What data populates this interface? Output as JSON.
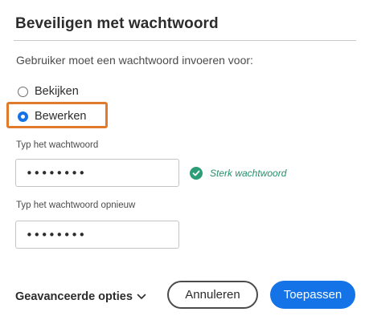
{
  "dialog": {
    "title": "Beveiligen met wachtwoord",
    "instruction": "Gebruiker moet een wachtwoord invoeren voor:",
    "options": [
      {
        "label": "Bekijken",
        "selected": false
      },
      {
        "label": "Bewerken",
        "selected": true
      }
    ],
    "password": {
      "label": "Typ het wachtwoord",
      "value": "••••••••",
      "strength": "Sterk wachtwoord"
    },
    "confirm": {
      "label": "Typ het wachtwoord opnieuw",
      "value": "••••••••"
    },
    "advanced_label": "Geavanceerde opties",
    "cancel_label": "Annuleren",
    "apply_label": "Toepassen"
  },
  "colors": {
    "accent": "#1473e6",
    "success": "#2d9d78",
    "highlight": "#e07a2d"
  },
  "icons": [
    "check-circle-icon",
    "chevron-down-icon"
  ]
}
